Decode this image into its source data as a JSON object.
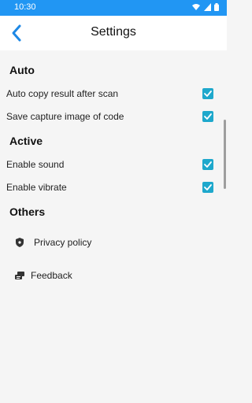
{
  "status_bar": {
    "time": "10:30",
    "icons": [
      "wifi-icon",
      "signal-icon",
      "battery-icon"
    ]
  },
  "app_bar": {
    "title": "Settings",
    "back_icon": "chevron-left-icon"
  },
  "colors": {
    "status_bar": "#2196F3",
    "back_arrow": "#1e88e5",
    "checkbox": "#1ea8cc"
  },
  "sections": {
    "auto": {
      "title": "Auto",
      "items": [
        {
          "label": "Auto copy result after scan",
          "checked": true
        },
        {
          "label": "Save capture image of code",
          "checked": true
        }
      ]
    },
    "active": {
      "title": "Active",
      "items": [
        {
          "label": "Enable sound",
          "checked": true
        },
        {
          "label": "Enable vibrate",
          "checked": true
        }
      ]
    },
    "others": {
      "title": "Others",
      "items": [
        {
          "label": "Privacy policy",
          "icon": "shield-icon"
        },
        {
          "label": "Feedback",
          "icon": "feedback-icon"
        }
      ]
    }
  }
}
